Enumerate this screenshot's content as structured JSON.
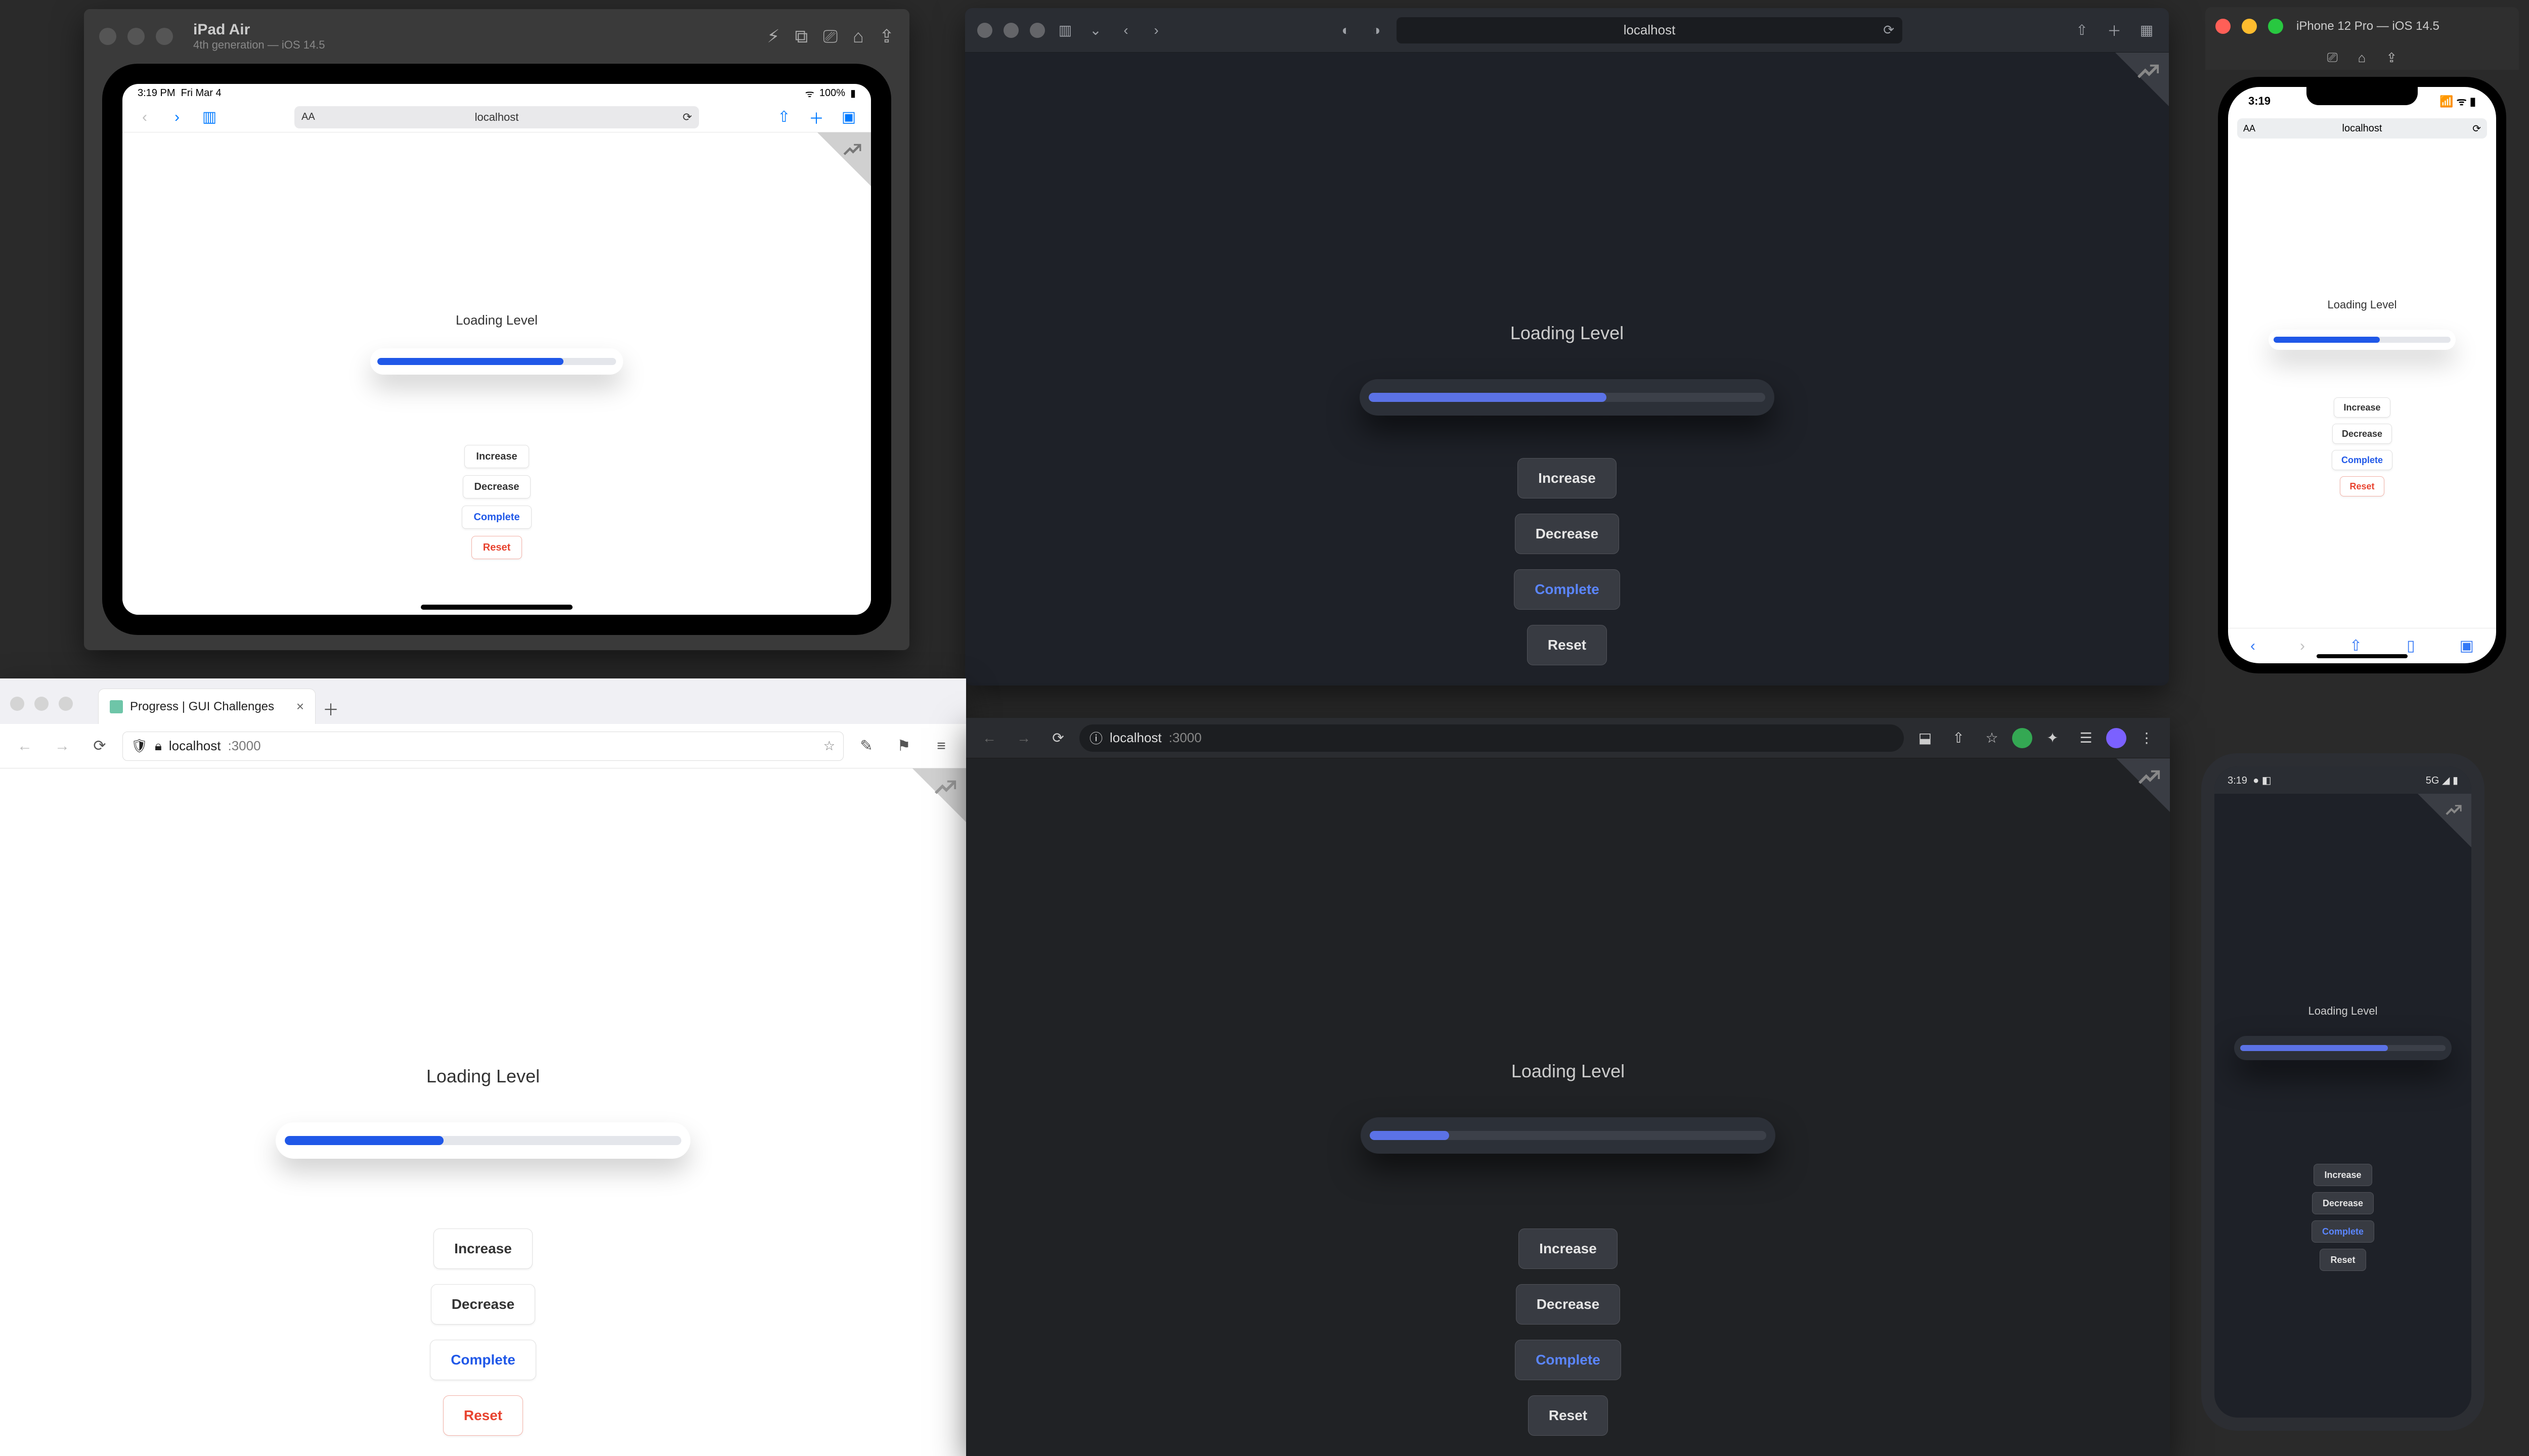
{
  "demo": {
    "label": "Loading Level",
    "buttons": {
      "increase": "Increase",
      "decrease": "Decrease",
      "complete": "Complete",
      "reset": "Reset"
    },
    "progress": {
      "safari_desktop_pct": 60,
      "ipad_pct": 78,
      "iphone_pct": 60,
      "firefox_pct": 40,
      "chrome_pct": 20,
      "android_pct": 72
    }
  },
  "ipad": {
    "device_name": "iPad Air",
    "device_sub": "4th generation — iOS 14.5",
    "status_time": "3:19 PM",
    "status_day": "Fri Mar 4",
    "wifi": "100%",
    "url": "localhost"
  },
  "safari_desktop": {
    "url": "localhost"
  },
  "firefox": {
    "tab_title": "Progress | GUI Challenges",
    "host": "localhost",
    "port": ":3000"
  },
  "chrome": {
    "host": "localhost",
    "port": ":3000"
  },
  "iphone": {
    "title": "iPhone 12 Pro — iOS 14.5",
    "time": "3:19",
    "url": "localhost"
  },
  "android": {
    "time": "3:19",
    "net_icon": "5G"
  },
  "colors": {
    "accent_dark": "#5b72e6",
    "accent_light": "#2058e8",
    "danger": "#e8432f"
  }
}
